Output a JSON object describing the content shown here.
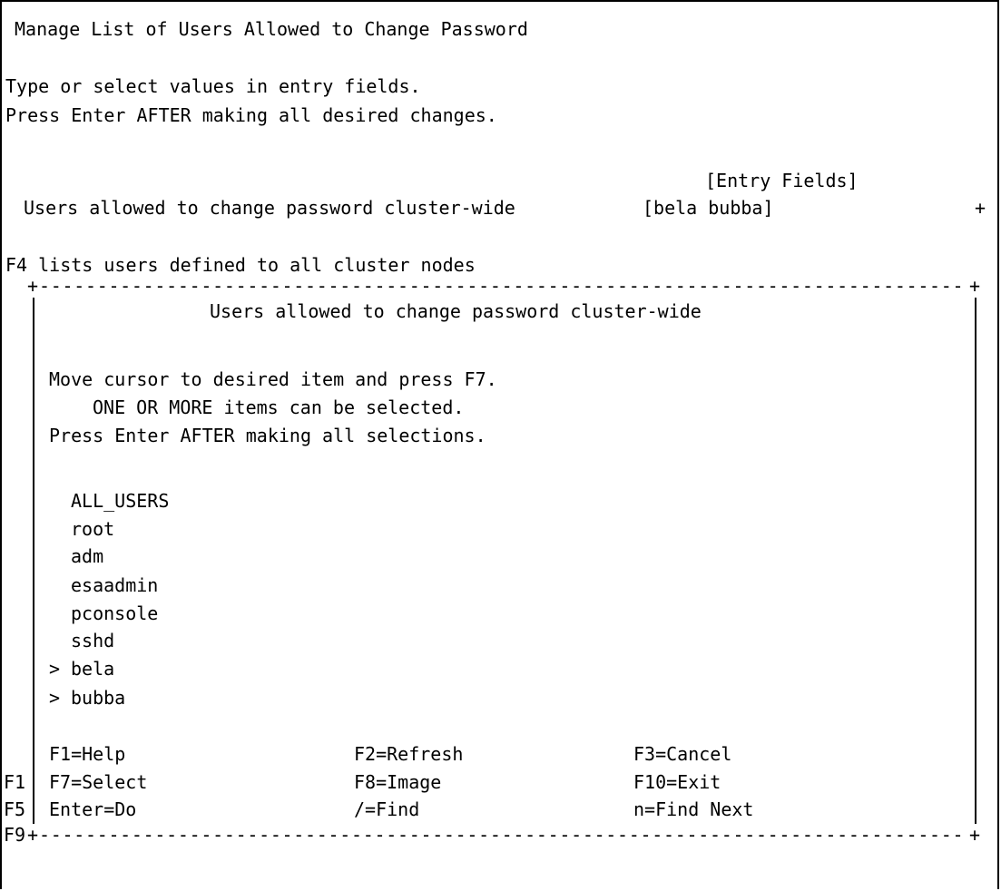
{
  "screen": {
    "title": "Manage List of Users Allowed to Change Password",
    "instructions": [
      "Type or select values in entry fields.",
      "Press Enter AFTER making all desired changes."
    ],
    "entry_fields_header": "[Entry Fields]",
    "field": {
      "label": "Users allowed to change password cluster-wide",
      "value": "[bela bubba]",
      "list_indicator": "+"
    },
    "f4_hint": "F4 lists users defined to all cluster nodes",
    "behind_keys": [
      "F1",
      "F5",
      "F9"
    ]
  },
  "popup": {
    "title": "Users allowed to change password cluster-wide",
    "instructions": [
      "Move cursor to desired item and press F7.",
      "ONE OR MORE items can be selected.",
      "Press Enter AFTER making all selections."
    ],
    "items": [
      {
        "name": "ALL_USERS",
        "selected": false
      },
      {
        "name": "root",
        "selected": false
      },
      {
        "name": "adm",
        "selected": false
      },
      {
        "name": "esaadmin",
        "selected": false
      },
      {
        "name": "pconsole",
        "selected": false
      },
      {
        "name": "sshd",
        "selected": false
      },
      {
        "name": "bela",
        "selected": true
      },
      {
        "name": "bubba",
        "selected": true
      }
    ],
    "selection_marker": ">",
    "function_keys": [
      [
        "F1=Help",
        "F2=Refresh",
        "F3=Cancel"
      ],
      [
        "F7=Select",
        "F8=Image",
        "F10=Exit"
      ],
      [
        "Enter=Do",
        "/=Find",
        "n=Find Next"
      ]
    ]
  }
}
